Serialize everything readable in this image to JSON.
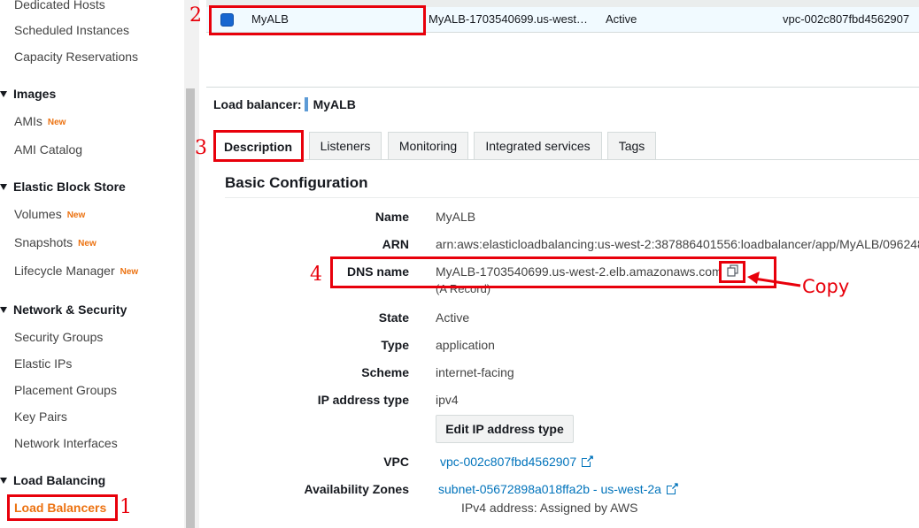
{
  "sidebar": {
    "instances_items": [
      "Dedicated Hosts",
      "Scheduled Instances",
      "Capacity Reservations"
    ],
    "images": {
      "heading": "Images",
      "items": [
        {
          "label": "AMIs",
          "badge": "New"
        },
        {
          "label": "AMI Catalog",
          "badge": ""
        }
      ]
    },
    "ebs": {
      "heading": "Elastic Block Store",
      "items": [
        {
          "label": "Volumes",
          "badge": "New"
        },
        {
          "label": "Snapshots",
          "badge": "New"
        },
        {
          "label": "Lifecycle Manager",
          "badge": "New"
        }
      ]
    },
    "network": {
      "heading": "Network & Security",
      "items": [
        "Security Groups",
        "Elastic IPs",
        "Placement Groups",
        "Key Pairs",
        "Network Interfaces"
      ]
    },
    "lb": {
      "heading": "Load Balancing",
      "items": [
        "Load Balancers"
      ]
    }
  },
  "table": {
    "row": {
      "name": "MyALB",
      "dns": "MyALB-1703540699.us-west…",
      "state": "Active",
      "vpc": "vpc-002c807fbd4562907"
    }
  },
  "details": {
    "title_label": "Load balancer:",
    "title_value": "MyALB",
    "tabs": [
      "Description",
      "Listeners",
      "Monitoring",
      "Integrated services",
      "Tags"
    ],
    "section": "Basic Configuration",
    "fields": {
      "name": {
        "label": "Name",
        "value": "MyALB"
      },
      "arn": {
        "label": "ARN",
        "value": "arn:aws:elasticloadbalancing:us-west-2:387886401556:loadbalancer/app/MyALB/096248"
      },
      "dns": {
        "label": "DNS name",
        "value": "MyALB-1703540699.us-west-2.elb.amazonaws.com",
        "sub": "(A Record)"
      },
      "state": {
        "label": "State",
        "value": "Active"
      },
      "type": {
        "label": "Type",
        "value": "application"
      },
      "scheme": {
        "label": "Scheme",
        "value": "internet-facing"
      },
      "ip_type": {
        "label": "IP address type",
        "value": "ipv4"
      },
      "vpc": {
        "label": "VPC",
        "value": "vpc-002c807fbd4562907"
      },
      "az": {
        "label": "Availability Zones",
        "value": "subnet-05672898a018ffa2b - us-west-2a",
        "sub": "IPv4 address: Assigned by AWS"
      }
    },
    "edit_ip_button": "Edit IP address type"
  },
  "annotations": {
    "step1": "1",
    "step2": "2",
    "step3": "3",
    "step4": "4",
    "copy_label": "Copy",
    "color": "#e8000b"
  },
  "colors": {
    "accent": "#ec7211",
    "link": "#0073bb",
    "selected_row": "#f1faff"
  }
}
